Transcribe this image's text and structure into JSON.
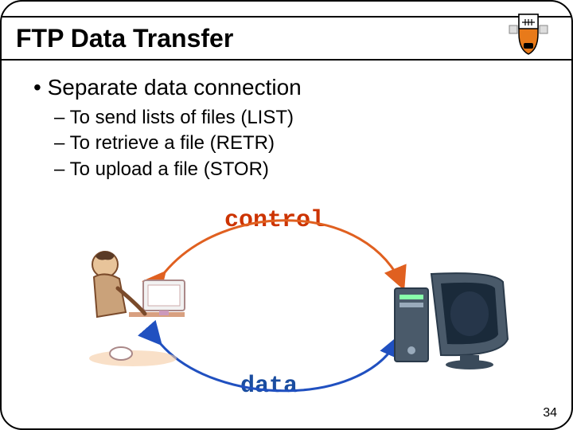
{
  "title": "FTP Data Transfer",
  "bullet": "• Separate data connection",
  "sub": {
    "a": "– To send lists of files (LIST)",
    "b": "– To retrieve a file (RETR)",
    "c": "– To upload a file (STOR)"
  },
  "labels": {
    "control": "control",
    "data": "data"
  },
  "pageNumber": "34",
  "iconNames": {
    "shield": "princeton-shield-icon",
    "user": "user-at-computer-icon",
    "server": "desktop-server-icon"
  }
}
